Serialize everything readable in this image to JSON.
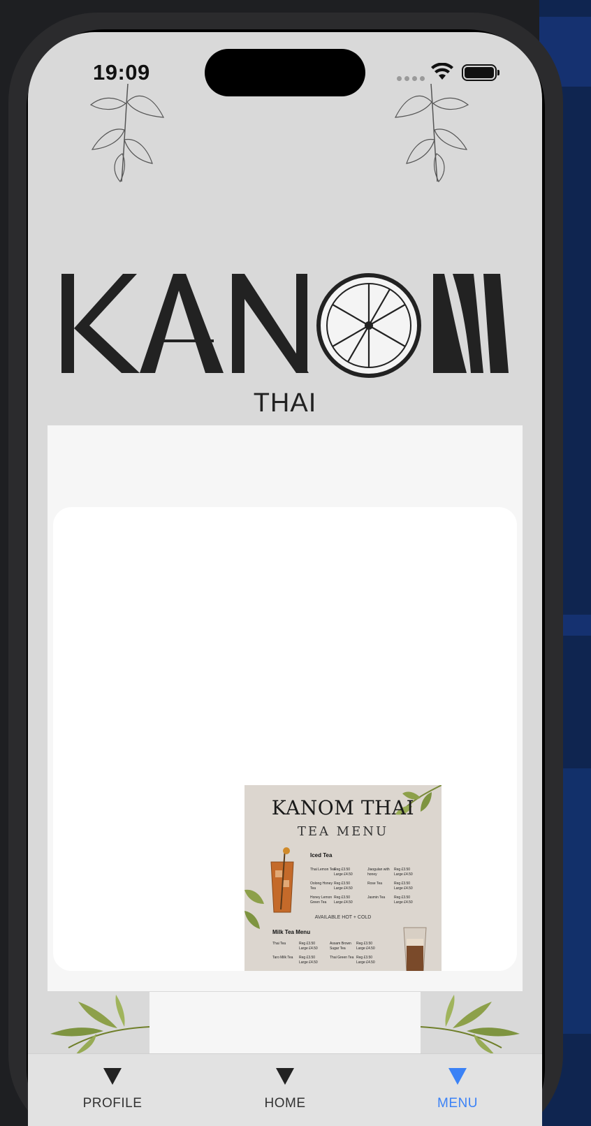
{
  "status_bar": {
    "time": "19:09"
  },
  "brand": {
    "logo_text": "KANOM",
    "sub_text": "THAI"
  },
  "menu_image": {
    "title": "KANOM THAI",
    "subtitle": "TEA MENU",
    "section_iced": "Iced Tea",
    "availability": "AVAILABLE HOT + COLD",
    "section_milk": "Milk Tea Menu",
    "iced_items": [
      {
        "name": "Thai Lemon Tea",
        "prices": "Reg £3.50 Large £4.50"
      },
      {
        "name": "Jiaogulan with honey",
        "prices": "Reg £3.50 Large £4.50"
      },
      {
        "name": "Oolong Honey Tea",
        "prices": "Reg £3.50 Large £4.50"
      },
      {
        "name": "Rose Tea",
        "prices": "Reg £3.50 Large £4.50"
      },
      {
        "name": "Honey Lemon Green Tea",
        "prices": "Reg £3.50 Large £4.50"
      },
      {
        "name": "Jasmin Tea",
        "prices": "Reg £3.50 Large £4.50"
      }
    ],
    "milk_items": [
      {
        "name": "Thai Tea",
        "prices": "Reg £3.50 Large £4.50"
      },
      {
        "name": "Assam Brown Sugar Tea",
        "prices": "Reg £3.50 Large £4.50"
      },
      {
        "name": "Taro Milk Tea",
        "prices": "Reg £3.50 Large £4.50"
      },
      {
        "name": "Thai Green Tea",
        "prices": "Reg £3.50 Large £4.50"
      }
    ]
  },
  "tab_bar": {
    "tabs": [
      {
        "label": "PROFILE",
        "active": false
      },
      {
        "label": "HOME",
        "active": false
      },
      {
        "label": "MENU",
        "active": true
      }
    ]
  },
  "colors": {
    "accent": "#3b82f6",
    "screen_bg": "#d9d9d9",
    "text_dark": "#222222"
  }
}
